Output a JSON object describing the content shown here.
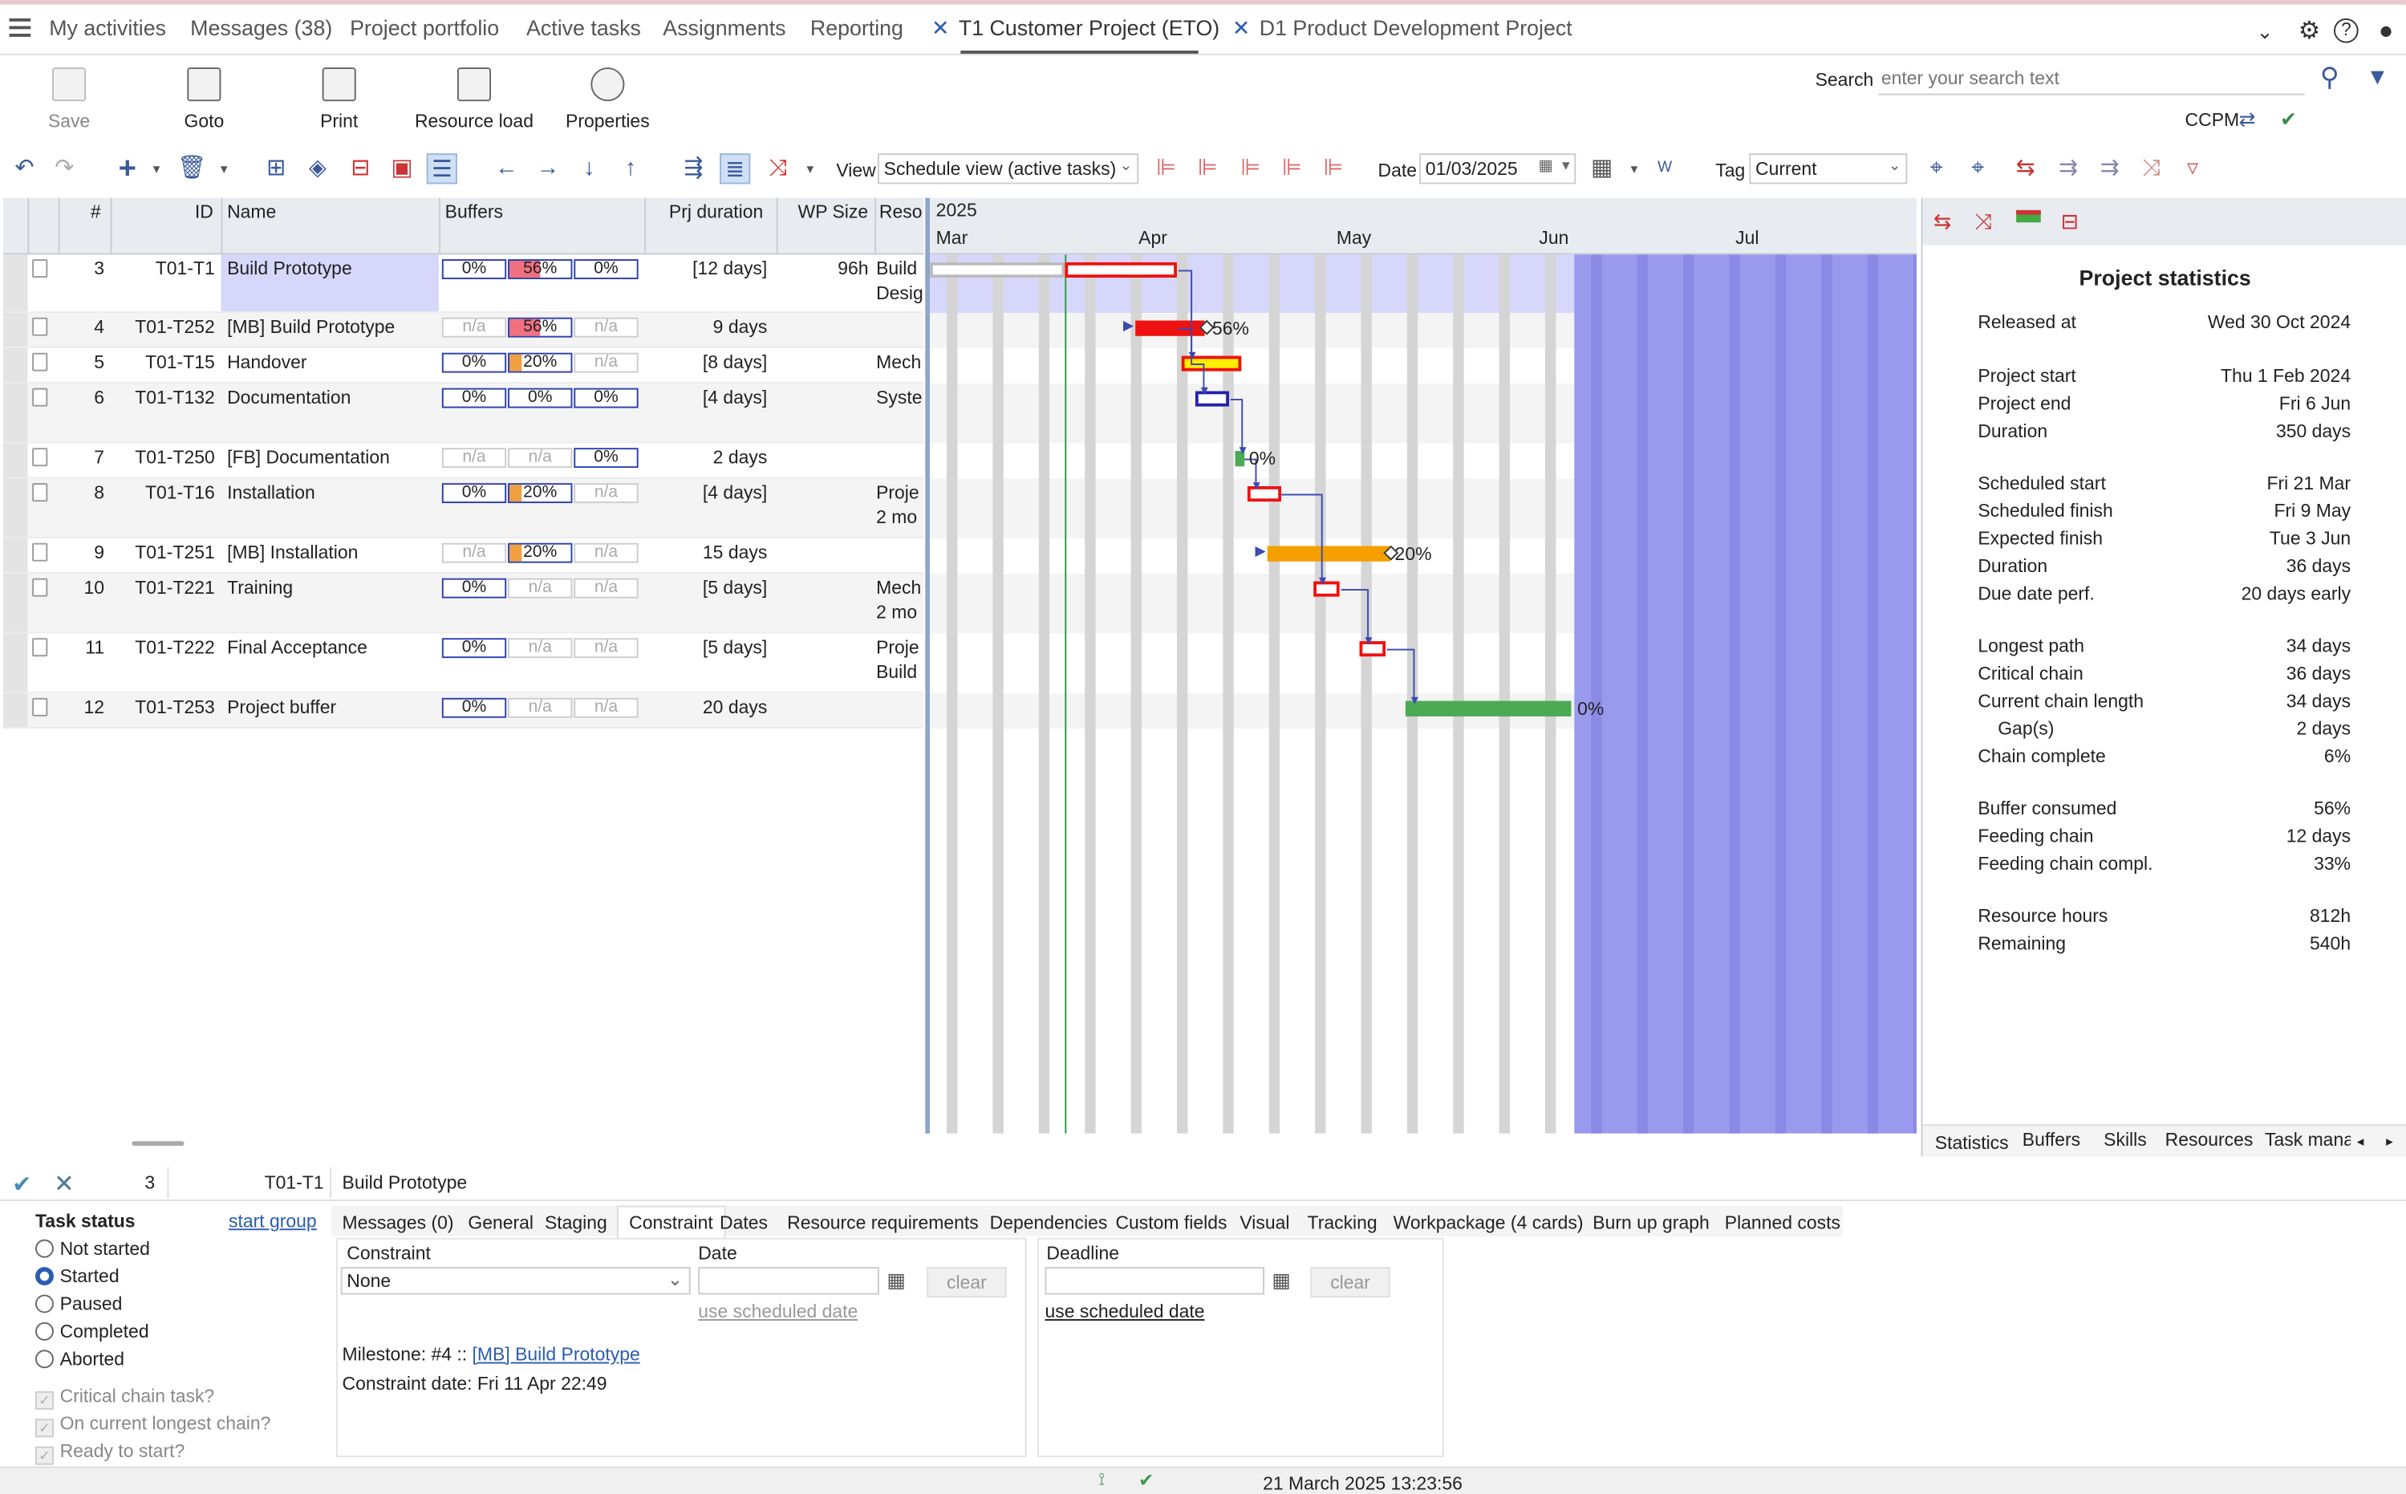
{
  "nav": {
    "tabs": [
      "My activities",
      "Messages (38)",
      "Project portfolio",
      "Active tasks",
      "Assignments",
      "Reporting"
    ],
    "open_projects": [
      "T1 Customer Project (ETO)",
      "D1 Product Development Project"
    ]
  },
  "ribbon": {
    "save": "Save",
    "goto": "Goto",
    "print": "Print",
    "resource_load": "Resource load",
    "properties": "Properties",
    "search_label": "Search",
    "search_placeholder": "enter your search text",
    "ccpm": "CCPM"
  },
  "toolbar": {
    "view_label": "View",
    "view_value": "Schedule view (active tasks)",
    "date_label": "Date",
    "date_value": "01/03/2025",
    "tag_label": "Tag",
    "tag_value": "Current"
  },
  "grid": {
    "headers": {
      "num": "#",
      "id": "ID",
      "name": "Name",
      "buffers": "Buffers",
      "prj_duration": "Prj duration",
      "wp_size": "WP Size",
      "reso": "Reso"
    },
    "rows": [
      {
        "num": "3",
        "id": "T01-T1",
        "name": "Build Prototype",
        "b1": "0%",
        "b2": "56%",
        "b3": "0%",
        "dur": "[12 days]",
        "wp": "96h",
        "reso": "Build",
        "reso2": "Desig"
      },
      {
        "num": "4",
        "id": "T01-T252",
        "name": "[MB]  Build Prototype",
        "b1": "n/a",
        "b2": "56%",
        "b3": "n/a",
        "dur": "9 days",
        "wp": "",
        "reso": "",
        "reso2": ""
      },
      {
        "num": "5",
        "id": "T01-T15",
        "name": "Handover",
        "b1": "0%",
        "b2": "20%",
        "b3": "n/a",
        "dur": "[8 days]",
        "wp": "",
        "reso": "Mech",
        "reso2": ""
      },
      {
        "num": "6",
        "id": "T01-T132",
        "name": "Documentation",
        "b1": "0%",
        "b2": "0%",
        "b3": "0%",
        "dur": "[4 days]",
        "wp": "",
        "reso": "Syste",
        "reso2": ""
      },
      {
        "num": "7",
        "id": "T01-T250",
        "name": "[FB]  Documentation",
        "b1": "n/a",
        "b2": "n/a",
        "b3": "0%",
        "dur": "2 days",
        "wp": "",
        "reso": "",
        "reso2": ""
      },
      {
        "num": "8",
        "id": "T01-T16",
        "name": "Installation",
        "b1": "0%",
        "b2": "20%",
        "b3": "n/a",
        "dur": "[4 days]",
        "wp": "",
        "reso": "Proje",
        "reso2": "2 mo"
      },
      {
        "num": "9",
        "id": "T01-T251",
        "name": "[MB]  Installation",
        "b1": "n/a",
        "b2": "20%",
        "b3": "n/a",
        "dur": "15 days",
        "wp": "",
        "reso": "",
        "reso2": ""
      },
      {
        "num": "10",
        "id": "T01-T221",
        "name": "Training",
        "b1": "0%",
        "b2": "n/a",
        "b3": "n/a",
        "dur": "[5 days]",
        "wp": "",
        "reso": "Mech",
        "reso2": "2 mo"
      },
      {
        "num": "11",
        "id": "T01-T222",
        "name": "Final Acceptance",
        "b1": "0%",
        "b2": "n/a",
        "b3": "n/a",
        "dur": "[5 days]",
        "wp": "",
        "reso": "Proje",
        "reso2": "Build"
      },
      {
        "num": "12",
        "id": "T01-T253",
        "name": "Project buffer",
        "b1": "0%",
        "b2": "n/a",
        "b3": "n/a",
        "dur": "20 days",
        "wp": "",
        "reso": "",
        "reso2": ""
      }
    ]
  },
  "gantt": {
    "year": "2025",
    "months": [
      "Mar",
      "Apr",
      "May",
      "Jun",
      "Jul"
    ],
    "labels": {
      "r4": "56%",
      "r7": "0%",
      "r9": "20%",
      "r12": "0%"
    },
    "colors": {
      "red": "#ee1111",
      "yellow": "#ffee00",
      "orange": "#f5a000",
      "green": "#4caa55",
      "blue": "#2222aa",
      "buffer_zone": "#9999ee"
    }
  },
  "stats": {
    "title": "Project statistics",
    "items": [
      {
        "k": "Released at",
        "v": "Wed 30 Oct 2024"
      },
      {
        "k": "Project start",
        "v": "Thu 1 Feb 2024"
      },
      {
        "k": "Project end",
        "v": "Fri 6 Jun"
      },
      {
        "k": "Duration",
        "v": "350 days"
      },
      {
        "k": "Scheduled start",
        "v": "Fri 21 Mar"
      },
      {
        "k": "Scheduled finish",
        "v": "Fri 9 May"
      },
      {
        "k": "Expected finish",
        "v": "Tue 3 Jun"
      },
      {
        "k": "Duration",
        "v": "36 days"
      },
      {
        "k": "Due date perf.",
        "v": "20 days early"
      },
      {
        "k": "Longest path",
        "v": "34 days"
      },
      {
        "k": "Critical chain",
        "v": "36 days"
      },
      {
        "k": "Current chain length",
        "v": "34 days"
      },
      {
        "k": "Gap(s)",
        "v": "2 days"
      },
      {
        "k": "Chain complete",
        "v": "6%"
      },
      {
        "k": "Buffer consumed",
        "v": "56%"
      },
      {
        "k": "Feeding chain",
        "v": "12 days"
      },
      {
        "k": "Feeding chain compl.",
        "v": "33%"
      },
      {
        "k": "Resource hours",
        "v": "812h"
      },
      {
        "k": "Remaining",
        "v": "540h"
      }
    ],
    "tabs": [
      "Statistics",
      "Buffers",
      "Skills",
      "Resources",
      "Task mana"
    ]
  },
  "editor": {
    "num": "3",
    "id": "T01-T1",
    "name": "Build Prototype",
    "task_status_label": "Task status",
    "start_group": "start group",
    "statuses": [
      "Not started",
      "Started",
      "Paused",
      "Completed",
      "Aborted"
    ],
    "checks": [
      "Critical chain task?",
      "On current longest chain?",
      "Ready to start?"
    ],
    "tabs": [
      "Messages (0)",
      "General",
      "Staging",
      "Constraint",
      "Dates",
      "Resource requirements",
      "Dependencies",
      "Custom fields",
      "Visual",
      "Tracking",
      "Workpackage (4 cards)",
      "Burn up graph",
      "Planned costs"
    ],
    "constraint_label": "Constraint",
    "constraint_value": "None",
    "date_label": "Date",
    "deadline_label": "Deadline",
    "clear": "clear",
    "use_scheduled_date": "use scheduled date",
    "milestone_prefix": "Milestone: #4 :: ",
    "milestone_link": "[MB]  Build Prototype",
    "constraint_date": "Constraint date: Fri 11 Apr 22:49"
  },
  "status_bar": {
    "datetime": "21 March 2025 13:23:56"
  }
}
